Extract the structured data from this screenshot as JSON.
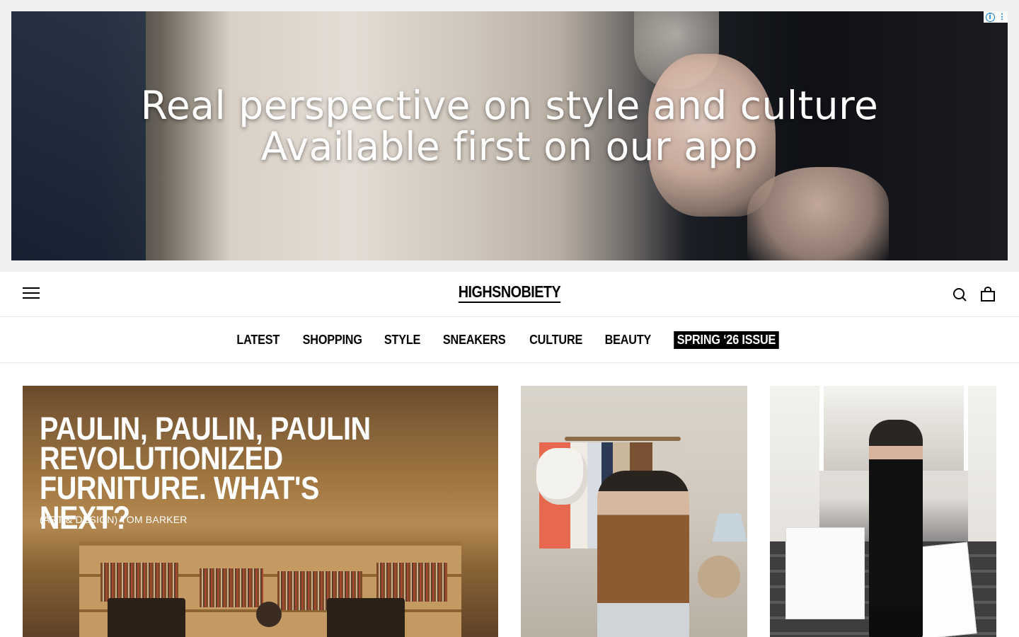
{
  "ad": {
    "line1": "Real perspective on style and culture",
    "line2": "Available first on our app",
    "choices_icon": "info-icon",
    "close_icon": "more-vertical-icon"
  },
  "header": {
    "logo": "HIGHSNOBIETY",
    "menu_icon": "hamburger-menu-icon",
    "search_icon": "search-icon",
    "bag_icon": "shopping-bag-icon"
  },
  "nav": {
    "items": [
      {
        "label": "LATEST"
      },
      {
        "label": "SHOPPING"
      },
      {
        "label": "STYLE"
      },
      {
        "label": "SNEAKERS"
      },
      {
        "label": "CULTURE"
      },
      {
        "label": "BEAUTY"
      },
      {
        "label": "SPRING ‘26 ISSUE"
      }
    ]
  },
  "cards": [
    {
      "title_line1": "PAULIN, PAULIN, PAULIN",
      "title_line2": "REVOLUTIONIZED",
      "title_line3": "FURNITURE. WHAT'S NEXT?",
      "meta": "(ART & DESIGN) TOM BARKER"
    },
    {},
    {}
  ],
  "colors": {
    "ad_background": "#efefef",
    "text": "#000000",
    "issue_badge_bg": "#000000",
    "issue_badge_text": "#ffffff",
    "divider": "#e6e6e6"
  }
}
